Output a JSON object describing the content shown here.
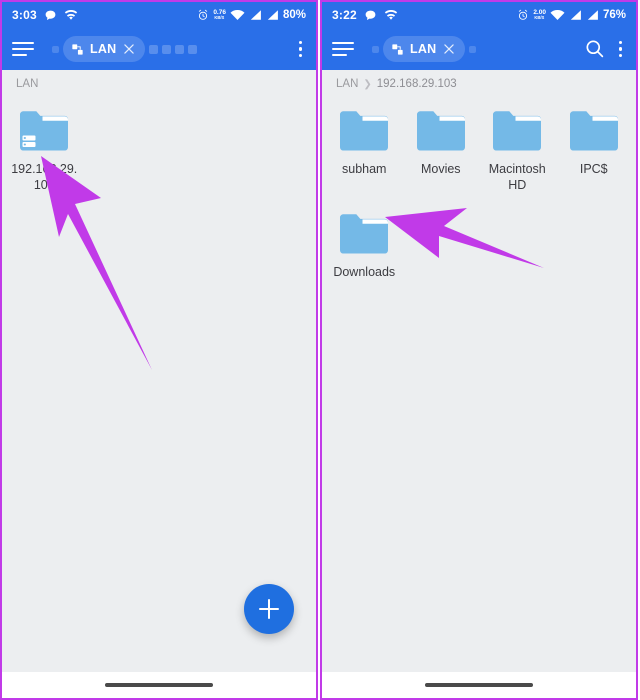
{
  "accent": {
    "toolbar_blue": "#2a6fe8",
    "fab_blue": "#1f6fe0",
    "folder_blue": "#74b9e7",
    "arrow_purple": "#c13ae8",
    "panel_border": "#c13ae8",
    "content_bg": "#eceef0"
  },
  "left_panel": {
    "statusbar": {
      "time": "3:03",
      "netspeed_top": "0.76",
      "netspeed_bottom": "KB/S",
      "battery": "80%",
      "icons": [
        "message-icon",
        "wifi-icon",
        "alarm-icon",
        "network-speed-icon",
        "wifi-signal-icon",
        "cellular-signal-1-icon",
        "cellular-signal-2-icon"
      ]
    },
    "toolbar": {
      "menu_icon": "hamburger-menu-icon",
      "tab_label": "LAN",
      "tab_icon": "network-tab-icon",
      "close_icon": "close-icon",
      "overflow_icon": "overflow-menu-icon"
    },
    "breadcrumb": [
      "LAN"
    ],
    "items": [
      {
        "label": "192.168.29.103",
        "icon": "server-folder-icon"
      }
    ],
    "fab": {
      "icon": "plus-icon",
      "label": "Add"
    },
    "annotation": "arrow-pointing-to-server-folder"
  },
  "right_panel": {
    "statusbar": {
      "time": "3:22",
      "netspeed_top": "2.00",
      "netspeed_bottom": "KB/S",
      "battery": "76%",
      "icons": [
        "message-icon",
        "wifi-icon",
        "alarm-icon",
        "network-speed-icon",
        "wifi-signal-icon",
        "cellular-signal-1-icon",
        "cellular-signal-2-icon"
      ]
    },
    "toolbar": {
      "menu_icon": "hamburger-menu-icon",
      "tab_label": "LAN",
      "tab_icon": "network-tab-icon",
      "close_icon": "close-icon",
      "search_icon": "search-icon",
      "overflow_icon": "overflow-menu-icon"
    },
    "breadcrumb": [
      "LAN",
      "192.168.29.103"
    ],
    "items": [
      {
        "label": "subham",
        "icon": "folder-icon"
      },
      {
        "label": "Movies",
        "icon": "folder-icon"
      },
      {
        "label": "Macintosh HD",
        "icon": "folder-icon"
      },
      {
        "label": "IPC$",
        "icon": "folder-icon"
      },
      {
        "label": "Downloads",
        "icon": "folder-icon"
      }
    ],
    "annotation": "arrow-pointing-to-downloads-folder"
  }
}
